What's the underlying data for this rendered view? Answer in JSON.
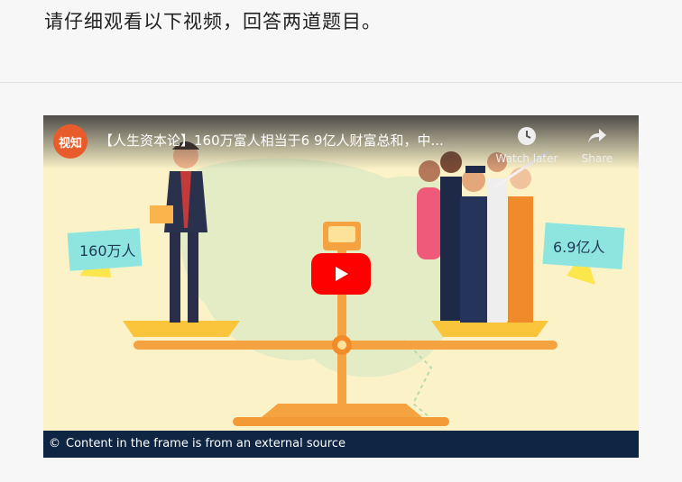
{
  "instruction": "请仔细观看以下视频，回答两道题目。",
  "video": {
    "channel_badge": "视知",
    "title": "【人生资本论】160万富人相当于6 9亿人财富总和，中...",
    "watch_later_label": "Watch later",
    "share_label": "Share",
    "left_sign": "160万人",
    "right_sign": "6.9亿人",
    "notice_icon": "©",
    "notice_text": "Content in the frame is from an external source"
  },
  "colors": {
    "accent_red": "#ff0000",
    "notice_bg": "#0f2544",
    "scale_orange": "#f4a340",
    "sign_teal": "#8ee5e0"
  },
  "icons": [
    "clock-icon",
    "share-arrow-icon",
    "play-icon"
  ]
}
